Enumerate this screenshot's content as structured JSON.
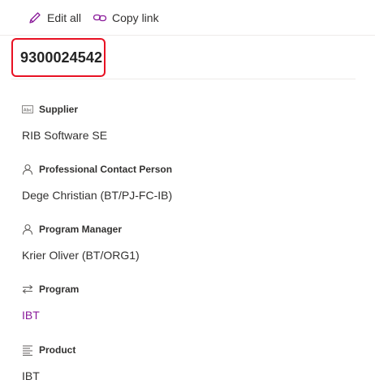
{
  "toolbar": {
    "edit_all_label": "Edit all",
    "copy_link_label": "Copy link",
    "edit_icon": "pencil-icon",
    "copy_icon": "link-icon"
  },
  "record": {
    "title": "9300024542"
  },
  "fields": [
    {
      "icon": "text-field-icon",
      "label": "Supplier",
      "value": "RIB Software SE",
      "is_link": false
    },
    {
      "icon": "person-icon",
      "label": "Professional Contact Person",
      "value": "Dege Christian (BT/PJ-FC-IB)",
      "is_link": false
    },
    {
      "icon": "person-icon",
      "label": "Program Manager",
      "value": "Krier Oliver (BT/ORG1)",
      "is_link": false
    },
    {
      "icon": "lookup-icon",
      "label": "Program",
      "value": "IBT",
      "is_link": true
    },
    {
      "icon": "choice-icon",
      "label": "Product",
      "value": "IBT",
      "is_link": false
    }
  ],
  "colors": {
    "highlight_border": "#e81123",
    "link": "#8a1b9a",
    "icon_accent": "#8a1b9a",
    "text": "#323130"
  }
}
